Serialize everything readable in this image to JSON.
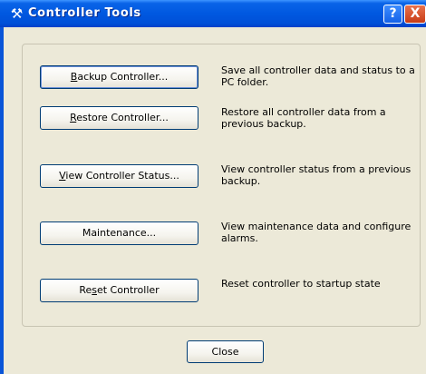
{
  "window": {
    "title": "Controller Tools",
    "help_glyph": "?",
    "close_glyph": "X"
  },
  "actions": [
    {
      "id": "backup",
      "label_before": "",
      "label_mnemonic": "B",
      "label_after": "ackup Controller...",
      "description": "Save all controller data and status to a PC folder."
    },
    {
      "id": "restore",
      "label_before": "",
      "label_mnemonic": "R",
      "label_after": "estore Controller...",
      "description": "Restore all controller data from a previous backup."
    },
    {
      "id": "view-status",
      "label_before": "",
      "label_mnemonic": "V",
      "label_after": "iew Controller Status...",
      "description": "View controller status from a previous backup."
    },
    {
      "id": "maintenance",
      "label_before": "Maintenance...",
      "label_mnemonic": "",
      "label_after": "",
      "description": "View maintenance data and configure alarms."
    },
    {
      "id": "reset",
      "label_before": "Re",
      "label_mnemonic": "s",
      "label_after": "et Controller",
      "description": "Reset controller to startup state"
    }
  ],
  "footer": {
    "close_label": "Close"
  }
}
